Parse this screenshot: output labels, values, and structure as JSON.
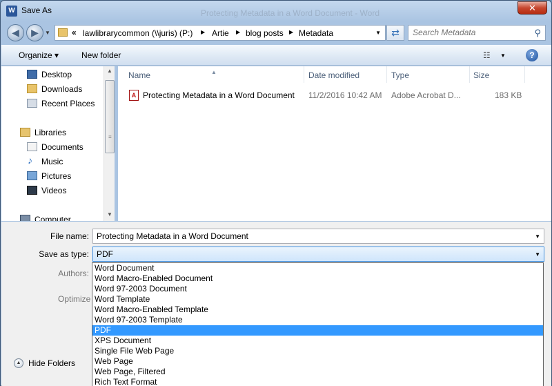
{
  "window": {
    "title": "Save As",
    "app_icon": "W",
    "ghost_title": "Protecting Metadata in a Word Document - Word",
    "close_label": "✕"
  },
  "address": {
    "overflow": "«",
    "crumbs": [
      "lawlibrarycommon (\\\\juris) (P:)",
      "Artie",
      "blog posts",
      "Metadata"
    ],
    "search_placeholder": "Search Metadata"
  },
  "toolbar": {
    "organize": "Organize ▾",
    "new_folder": "New folder"
  },
  "nav": {
    "items": [
      {
        "label": "Desktop",
        "icon": "desktop-icon"
      },
      {
        "label": "Downloads",
        "icon": "downloads-icon"
      },
      {
        "label": "Recent Places",
        "icon": "recent-places-icon"
      },
      {
        "label": "Libraries",
        "icon": "libraries-icon"
      },
      {
        "label": "Documents",
        "icon": "documents-icon"
      },
      {
        "label": "Music",
        "icon": "music-icon"
      },
      {
        "label": "Pictures",
        "icon": "pictures-icon"
      },
      {
        "label": "Videos",
        "icon": "videos-icon"
      },
      {
        "label": "Computer",
        "icon": "computer-icon"
      }
    ]
  },
  "columns": {
    "name": "Name",
    "date": "Date modified",
    "type": "Type",
    "size": "Size"
  },
  "files": [
    {
      "name": "Protecting Metadata in a Word Document",
      "date": "11/2/2016 10:42 AM",
      "type": "Adobe Acrobat D...",
      "size": "183 KB"
    }
  ],
  "form": {
    "file_name_label": "File name:",
    "file_name_value": "Protecting Metadata in a Word Document",
    "save_type_label": "Save as type:",
    "save_type_value": "PDF",
    "authors_label": "Authors:",
    "optimize_label": "Optimize"
  },
  "type_options": [
    "Word Document",
    "Word Macro-Enabled Document",
    "Word 97-2003 Document",
    "Word Template",
    "Word Macro-Enabled Template",
    "Word 97-2003 Template",
    "PDF",
    "XPS Document",
    "Single File Web Page",
    "Web Page",
    "Web Page, Filtered",
    "Rich Text Format"
  ],
  "selected_type": "PDF",
  "hide_folders": "Hide Folders",
  "colors": {
    "selection": "#3399ff",
    "window_frame": "#aac4e2"
  }
}
